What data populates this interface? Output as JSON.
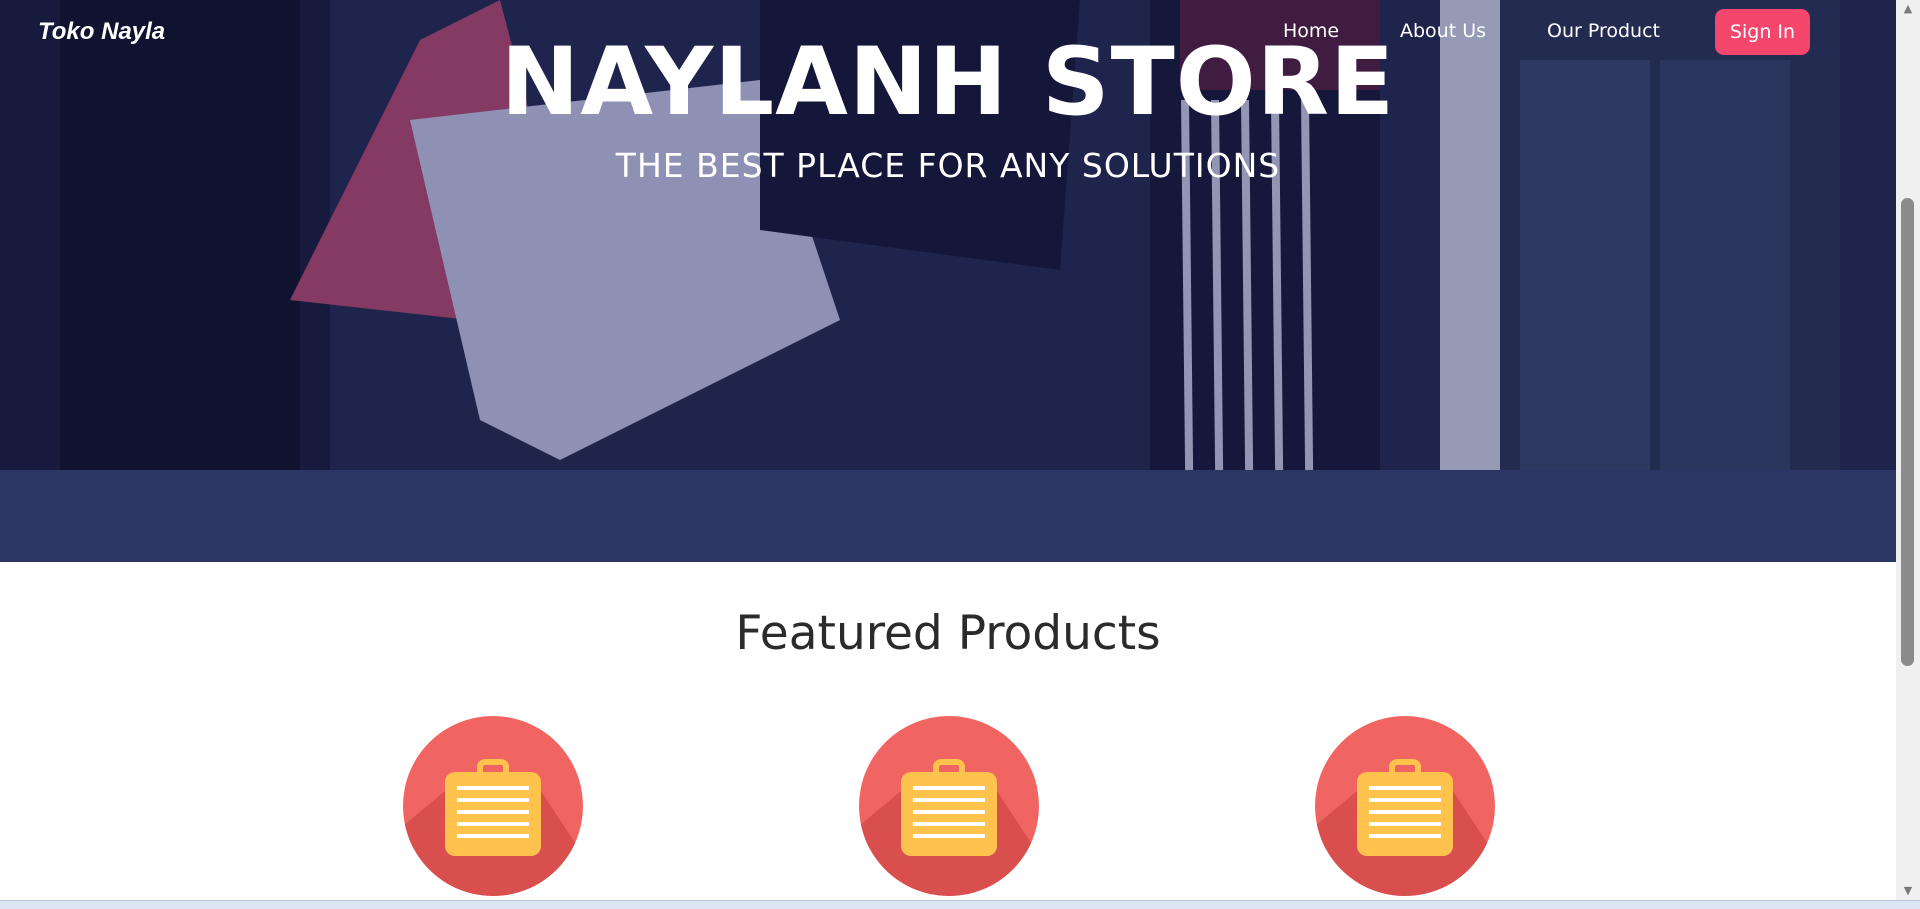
{
  "brand": "Toko Nayla",
  "nav": {
    "home": "Home",
    "about": "About Us",
    "product": "Our Product",
    "signin": "Sign In"
  },
  "hero": {
    "title": "NAYLANH STORE",
    "subtitle": "THE BEST PLACE FOR ANY SOLUTIONS"
  },
  "featured": {
    "title": "Featured Products",
    "items": [
      {
        "icon": "suitcase-icon"
      },
      {
        "icon": "suitcase-icon"
      },
      {
        "icon": "suitcase-icon"
      }
    ]
  },
  "colors": {
    "accent": "#f5476c",
    "product_circle": "#f06561",
    "suitcase": "#ffc34d"
  }
}
